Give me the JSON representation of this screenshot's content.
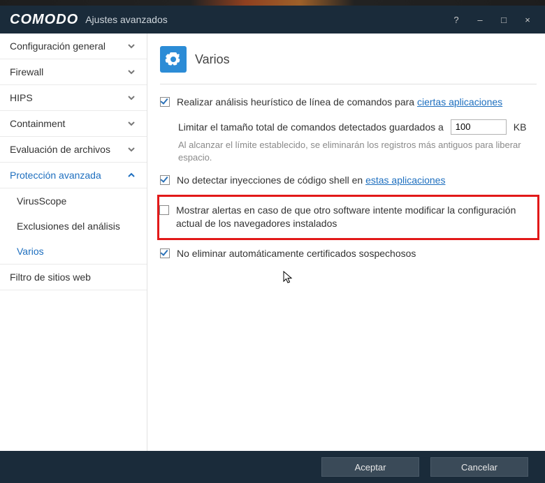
{
  "window": {
    "brand": "COMODO",
    "title": "Ajustes avanzados"
  },
  "titlebar_buttons": {
    "help": "?",
    "min": "–",
    "max": "□",
    "close": "×"
  },
  "sidebar": {
    "items": [
      {
        "label": "Configuración general",
        "expanded": false,
        "active": false,
        "hasChildren": true
      },
      {
        "label": "Firewall",
        "expanded": false,
        "active": false,
        "hasChildren": true
      },
      {
        "label": "HIPS",
        "expanded": false,
        "active": false,
        "hasChildren": true
      },
      {
        "label": "Containment",
        "expanded": false,
        "active": false,
        "hasChildren": true
      },
      {
        "label": "Evaluación de archivos",
        "expanded": false,
        "active": false,
        "hasChildren": true
      },
      {
        "label": "Protección avanzada",
        "expanded": true,
        "active": true,
        "hasChildren": true
      },
      {
        "label": "Filtro de sitios web",
        "expanded": false,
        "active": false,
        "hasChildren": false
      }
    ],
    "sub_items": [
      {
        "label": "VirusScope",
        "active": false
      },
      {
        "label": "Exclusiones del análisis",
        "active": false
      },
      {
        "label": "Varios",
        "active": true
      }
    ]
  },
  "page": {
    "title": "Varios",
    "opt1_prefix": "Realizar análisis heurístico de línea de comandos para ",
    "opt1_link": "ciertas aplicaciones",
    "opt1_checked": true,
    "limit_label_prefix": "Limitar el tamaño total de comandos detectados guardados a",
    "limit_value": "100",
    "limit_suffix": "KB",
    "limit_help": "Al alcanzar el límite establecido, se eliminarán los registros más antiguos para liberar espacio.",
    "opt2_prefix": "No detectar inyecciones de código shell en ",
    "opt2_link": "estas aplicaciones",
    "opt2_checked": true,
    "opt3_label": "Mostrar alertas en caso de que otro software intente modificar la configuración actual de los navegadores instalados",
    "opt3_checked": false,
    "opt4_label": "No eliminar automáticamente certificados sospechosos",
    "opt4_checked": true
  },
  "footer": {
    "accept": "Aceptar",
    "cancel": "Cancelar"
  }
}
